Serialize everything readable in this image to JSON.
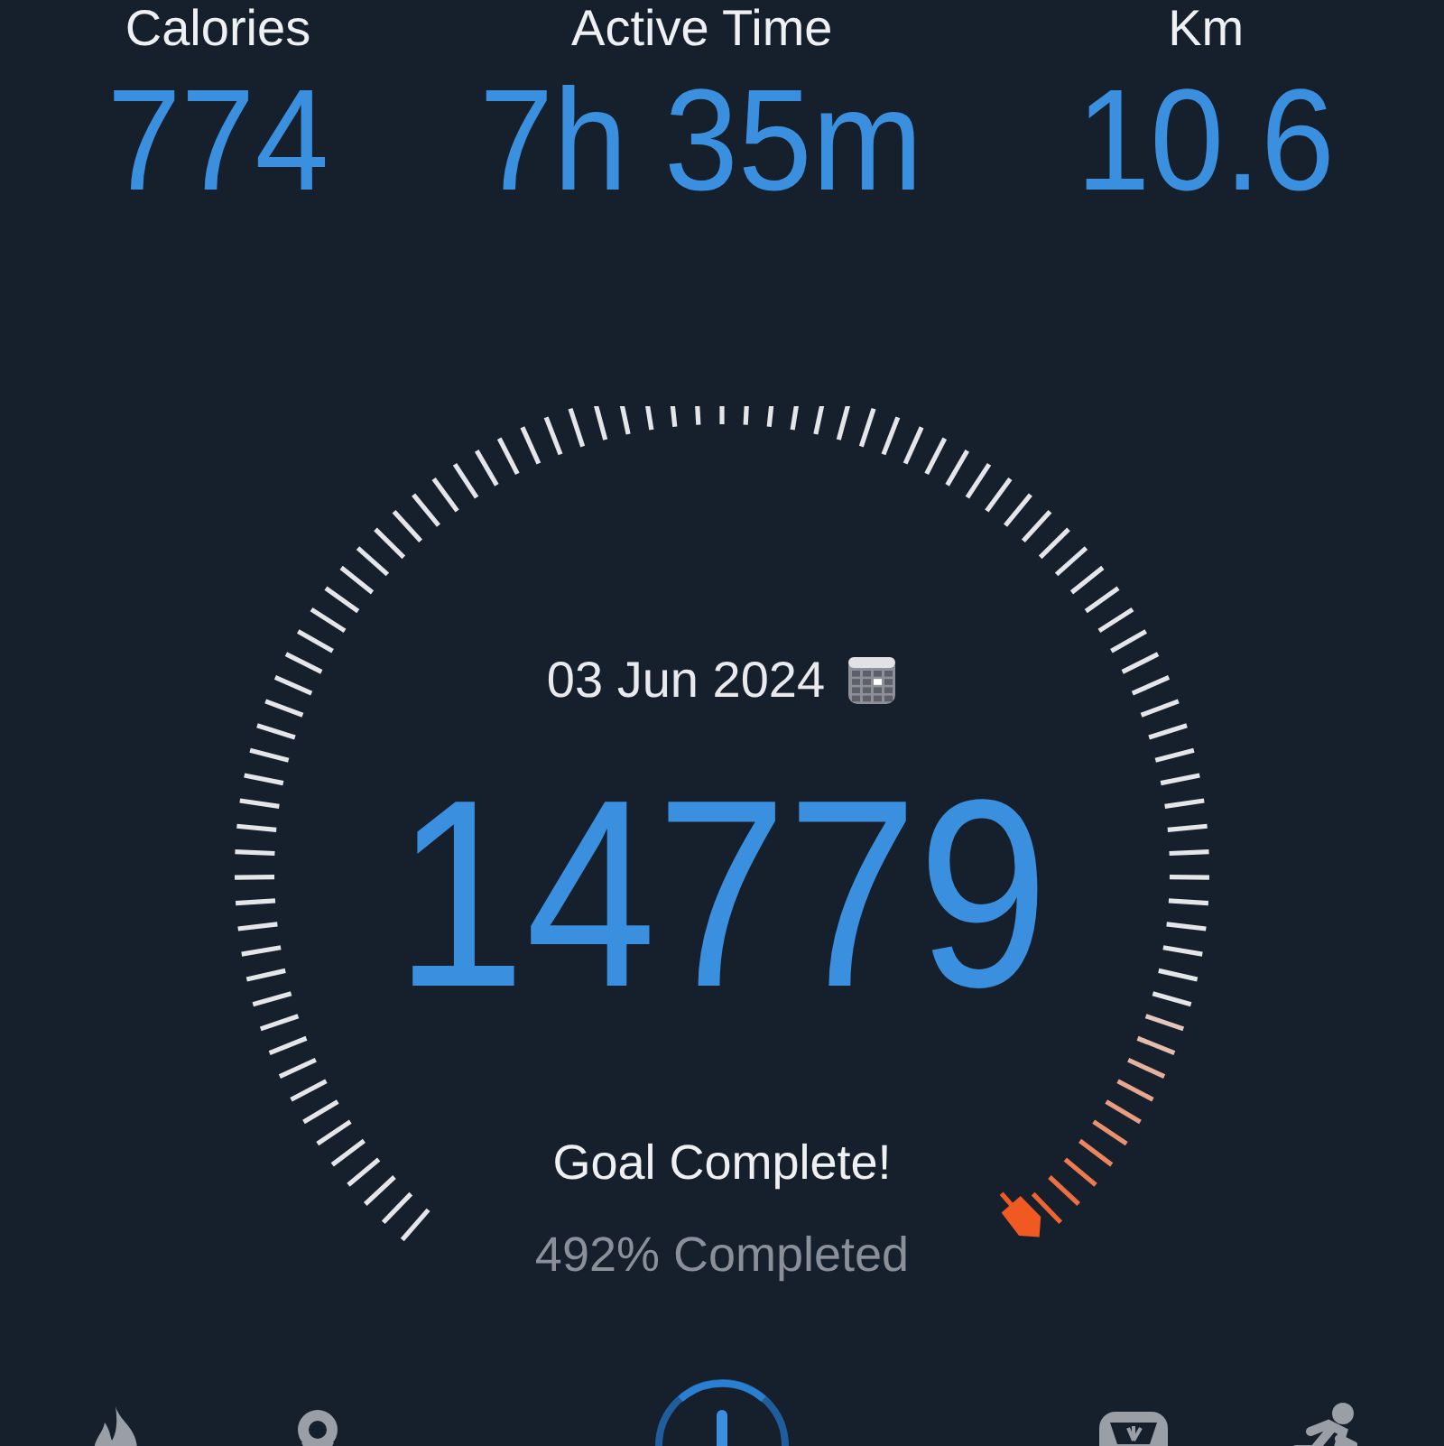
{
  "stats": [
    {
      "label": "Calories",
      "value": "774"
    },
    {
      "label": "Active Time",
      "value": "7h 35m"
    },
    {
      "label": "Km",
      "value": "10.6"
    }
  ],
  "goal": {
    "date": "03 Jun 2024",
    "steps": "14779",
    "status": "Goal Complete!",
    "completed": "492% Completed"
  },
  "nav": [
    {
      "kind": "flame"
    },
    {
      "kind": "pin"
    },
    {
      "kind": "add"
    },
    {
      "kind": "scale"
    },
    {
      "kind": "runner"
    }
  ]
}
